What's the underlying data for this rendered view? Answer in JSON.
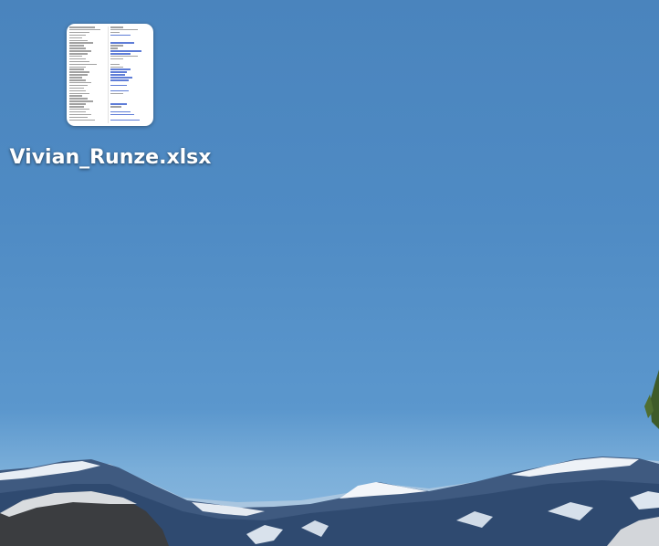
{
  "desktop": {
    "files": [
      {
        "name": "Vivian_Runze.xlsx",
        "type": "spreadsheet",
        "icon": "xlsx-file-thumbnail-icon"
      }
    ]
  }
}
